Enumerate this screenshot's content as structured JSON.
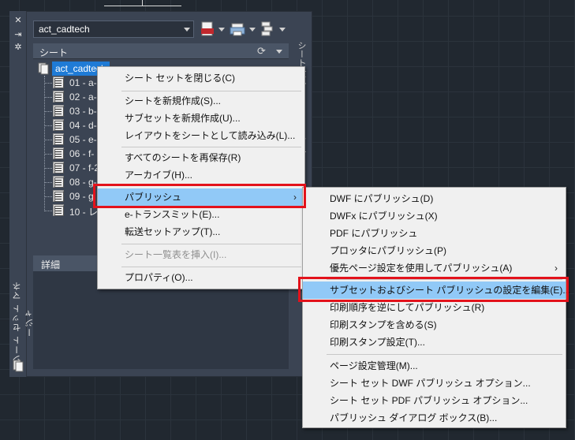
{
  "palette": {
    "vertical_title": "シート セット マネージャ",
    "drawing_combo_value": "act_cadtech",
    "sheets_header": "シート",
    "details_header": "詳細",
    "side_tab_1": "シート一覧",
    "side_tab_2": "ビュー"
  },
  "tree": {
    "root_label": "act_cadtech",
    "sheets": [
      "01 - a-",
      "02 - a-",
      "03 - b-",
      "04 - d-",
      "05 - e-",
      "06 - f-",
      "07 - f-2",
      "08 - g-",
      "09 - g",
      "10 - レ"
    ]
  },
  "context_menu": {
    "close_sheet_set": "シート セットを閉じる(C)",
    "new_sheet": "シートを新規作成(S)...",
    "new_subset": "サブセットを新規作成(U)...",
    "import_layout": "レイアウトをシートとして読み込み(L)...",
    "resave_all": "すべてのシートを再保存(R)",
    "archive": "アーカイブ(H)...",
    "publish": "パブリッシュ",
    "etransmit": "e-トランスミット(E)...",
    "transfer_setup": "転送セットアップ(T)...",
    "insert_sheet_list": "シート一覧表を挿入(I)...",
    "properties": "プロパティ(O)...",
    "submenu_arrow": "›"
  },
  "publish_submenu": {
    "dwf": "DWF にパブリッシュ(D)",
    "dwfx": "DWFx にパブリッシュ(X)",
    "pdf": "PDF にパブリッシュ",
    "plotter": "プロッタにパブリッシュ(P)",
    "page_override": "優先ページ設定を使用してパブリッシュ(A)",
    "edit_settings": "サブセットおよびシート パブリッシュの設定を編集(E)...",
    "reverse_order": "印刷順序を逆にしてパブリッシュ(R)",
    "include_stamp": "印刷スタンプを含める(S)",
    "stamp_settings": "印刷スタンプ設定(T)...",
    "page_setup_manager": "ページ設定管理(M)...",
    "dwf_options": "シート セット DWF パブリッシュ オプション...",
    "pdf_options": "シート セット PDF パブリッシュ オプション...",
    "dialog_box": "パブリッシュ ダイアログ ボックス(B)...",
    "submenu_arrow": "›"
  },
  "colors": {
    "highlight": "#91c9f7",
    "callout": "#e3121b",
    "selection": "#1f7bd6"
  }
}
